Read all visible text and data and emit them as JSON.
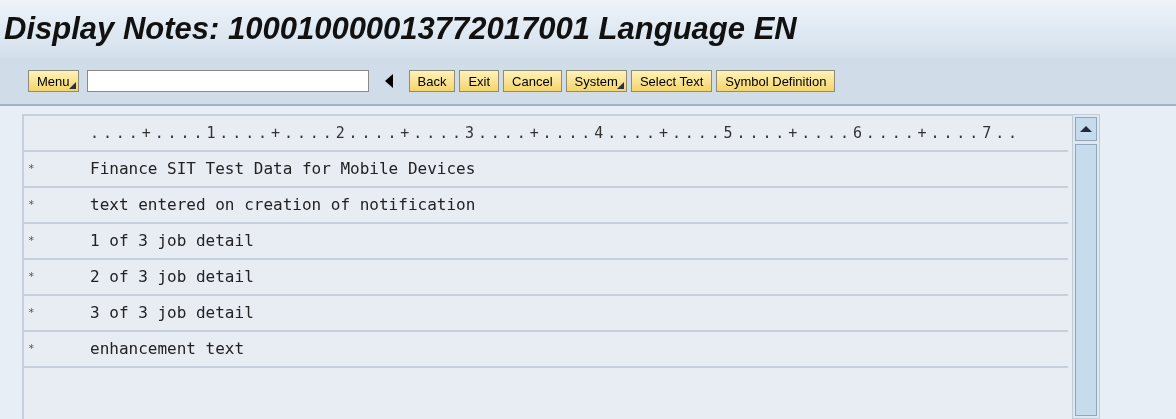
{
  "window": {
    "title": "Display Notes: 100010000013772017001 Language EN"
  },
  "toolbar": {
    "buttons": [
      {
        "label": "Menu",
        "kind": "menu"
      },
      {
        "label": "Back",
        "kind": "plain"
      },
      {
        "label": "Exit",
        "kind": "plain"
      },
      {
        "label": "Cancel",
        "kind": "plain"
      },
      {
        "label": "System",
        "kind": "menu"
      },
      {
        "label": "Select Text",
        "kind": "plain"
      },
      {
        "label": "Symbol Definition",
        "kind": "plain"
      }
    ]
  },
  "editor": {
    "ruler": "....+....1....+....2....+....3....+....4....+....5....+....6....+....7..",
    "lines": [
      {
        "format": "*",
        "text": "Finance SIT Test Data for Mobile Devices"
      },
      {
        "format": "*",
        "text": "text entered on creation of notification"
      },
      {
        "format": "*",
        "text": "1 of 3 job detail"
      },
      {
        "format": "*",
        "text": "2 of 3 job detail"
      },
      {
        "format": "*",
        "text": "3 of 3 job detail"
      },
      {
        "format": "*",
        "text": "enhancement text"
      }
    ]
  }
}
